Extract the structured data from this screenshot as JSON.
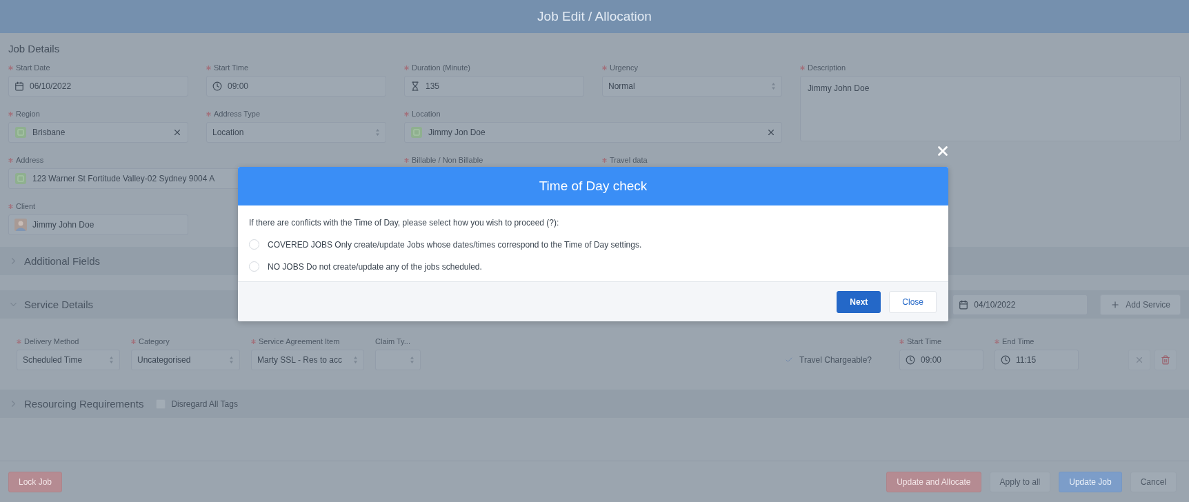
{
  "header": {
    "title": "Job Edit / Allocation"
  },
  "job_details": {
    "title": "Job Details",
    "fields": [
      {
        "label": "Start Date",
        "required": true,
        "kind": "date",
        "value": "06/10/2022"
      },
      {
        "label": "Start Time",
        "required": true,
        "kind": "time",
        "value": "09:00"
      },
      {
        "label": "Duration (Minute)",
        "required": true,
        "kind": "duration",
        "value": "135"
      },
      {
        "label": "Urgency",
        "required": true,
        "kind": "select",
        "value": "Normal"
      },
      {
        "label": "Region",
        "required": true,
        "kind": "lookup",
        "value": "Brisbane",
        "clearable": true
      },
      {
        "label": "Address Type",
        "required": true,
        "kind": "select",
        "value": "Location"
      },
      {
        "label": "Location",
        "required": true,
        "kind": "wide_lookup",
        "value": "Jimmy Jon Doe",
        "clearable": true
      },
      {
        "label": "Address",
        "required": true,
        "kind": "wide_lookup",
        "value": "123 Warner St Fortitude Valley-02 Sydney 9004 A"
      },
      {
        "label": "Billable / Non Billable",
        "required": true,
        "kind": "label"
      },
      {
        "label": "Travel data",
        "required": true,
        "kind": "label"
      },
      {
        "label": "Client",
        "required": true,
        "kind": "person",
        "value": "Jimmy John Doe"
      }
    ],
    "description": {
      "label": "Description",
      "required": true,
      "value": "Jimmy John Doe"
    }
  },
  "sections": [
    {
      "kind": "additional",
      "title": "Additional Fields",
      "expanded": false
    },
    {
      "kind": "service",
      "title": "Service Details",
      "expanded": true,
      "date": "04/10/2022",
      "add_button": "Add Service",
      "fields": [
        {
          "label": "Delivery Method",
          "required": true,
          "value": "Scheduled Time"
        },
        {
          "label": "Category",
          "required": true,
          "value": "Uncategorised"
        },
        {
          "label": "Service Agreement Item",
          "required": true,
          "value": "Marty SSL - Res to acc"
        },
        {
          "label": "Claim Ty...",
          "required": false
        }
      ],
      "travel": {
        "label": "Travel Chargeable?",
        "checked": true
      },
      "times": [
        {
          "label": "Start Time",
          "required": true,
          "value": "09:00"
        },
        {
          "label": "End Time",
          "required": true,
          "value": "11:15"
        }
      ]
    },
    {
      "kind": "resourcing",
      "title": "Resourcing Requirements",
      "expanded": false,
      "checkbox": {
        "label": "Disregard All Tags",
        "checked": false
      }
    }
  ],
  "footer": {
    "left": [
      {
        "label": "Lock Job",
        "kind": "danger"
      }
    ],
    "right": [
      {
        "label": "Update and Allocate",
        "kind": "danger"
      },
      {
        "label": "Apply to all",
        "kind": "default"
      },
      {
        "label": "Update Job",
        "kind": "primary"
      },
      {
        "label": "Cancel",
        "kind": "default"
      }
    ]
  },
  "modal": {
    "title": "Time of Day check",
    "prompt": "If there are conflicts with the Time of Day, please select how you wish to proceed (?):",
    "options": [
      {
        "label": "COVERED JOBS Only create/update Jobs whose dates/times correspond to the Time of Day settings.",
        "selected": false
      },
      {
        "label": "NO JOBS Do not create/update any of the jobs scheduled.",
        "selected": false
      }
    ],
    "buttons": [
      {
        "label": "Next",
        "kind": "primary"
      },
      {
        "label": "Close",
        "kind": "default"
      }
    ]
  }
}
